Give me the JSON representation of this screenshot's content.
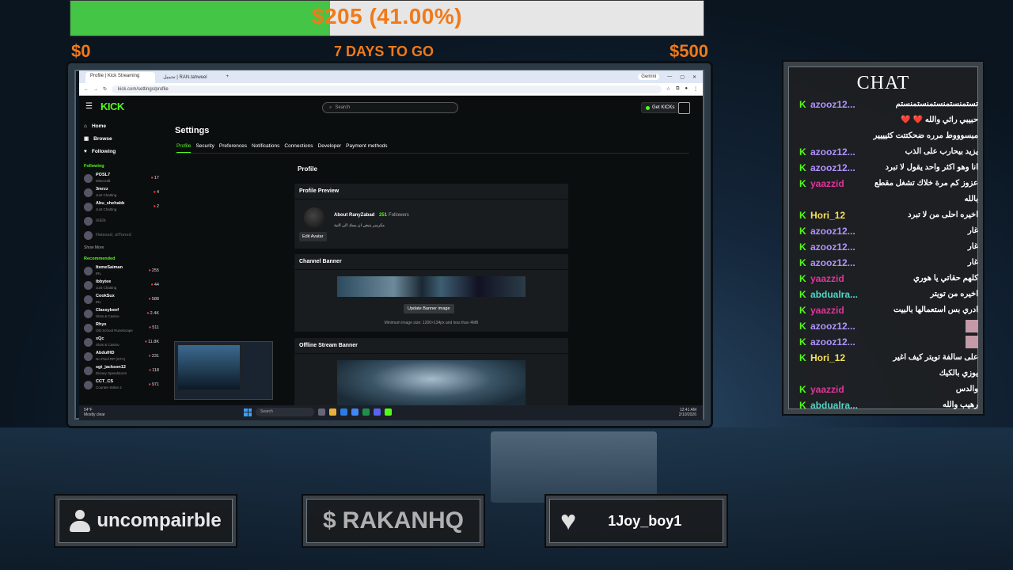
{
  "goal": {
    "amount_text": "$205 (41.00%)",
    "progress_pct": 41,
    "min": "$0",
    "max": "$500",
    "days_left": "7 DAYS TO GO"
  },
  "browser": {
    "tab1": "Profile | Kick Streaming",
    "tab2": "تحميل | RAN.tahweel",
    "gemini": "Gemini",
    "url": "kick.com/settings/profile"
  },
  "kick": {
    "logo": "KICK",
    "search_placeholder": "Search",
    "get_kicks": "Get KICKs",
    "nav": [
      {
        "label": "Home"
      },
      {
        "label": "Browse"
      },
      {
        "label": "Following"
      }
    ],
    "following_title": "Following",
    "following": [
      {
        "name": "POSL7",
        "cat": "Minecraft",
        "count": "17",
        "live": true
      },
      {
        "name": "3mrzz",
        "cat": "Just Chatting",
        "count": "4",
        "live": true
      },
      {
        "name": "Abu_shehabb",
        "cat": "Just Chatting",
        "count": "2",
        "live": true
      },
      {
        "name": "iiiElk",
        "cat": "",
        "count": "",
        "live": false
      },
      {
        "name": "Haiasad_alTonsd",
        "cat": "",
        "count": "",
        "live": false
      }
    ],
    "show_more": "Show More",
    "recommended_title": "Recommended",
    "recommended": [
      {
        "name": "ItsmeSaiman",
        "cat": "IRL",
        "count": "255"
      },
      {
        "name": "ibbytee",
        "cat": "Just Chatting",
        "count": "44"
      },
      {
        "name": "CookSux",
        "cat": "IRL",
        "count": "588"
      },
      {
        "name": "Classybeef",
        "cat": "Slots & Casino",
        "count": "2.4K"
      },
      {
        "name": "Rhys",
        "cat": "Old School RuneScape",
        "count": "511"
      },
      {
        "name": "xQc",
        "cat": "Slots & Casino",
        "count": "11.8K"
      },
      {
        "name": "AbduIHD",
        "cat": "No Pixel RP (GTA)",
        "count": "231"
      },
      {
        "name": "sgt_jackson12",
        "cat": "Disney Speedstorm",
        "count": "118"
      },
      {
        "name": "CCT_CS",
        "cat": "Counter-Strike 2",
        "count": "971"
      }
    ],
    "settings_title": "Settings",
    "tabs": [
      "Profile",
      "Security",
      "Preferences",
      "Notifications",
      "Connections",
      "Developer",
      "Payment methods"
    ],
    "page_title": "Profile",
    "preview": {
      "heading": "Profile Preview",
      "about": "About RanyZabad",
      "followers_count": "251",
      "followers_label": "Followers",
      "bio": "مكرمبر ينبغي ان يسك الى النية",
      "edit_avatar": "Edit Avatar"
    },
    "banner": {
      "heading": "Channel Banner",
      "update": "Update Banner image",
      "min": "Minimum image size: 1200×134px and less than 4MB"
    },
    "offline": {
      "heading": "Offline Stream Banner"
    }
  },
  "taskbar": {
    "weather_temp": "54°F",
    "weather_desc": "Mostly clear",
    "search": "Search",
    "time": "12:41 AM",
    "date": "2/10/2026"
  },
  "chat": {
    "title": "CHAT",
    "messages": [
      {
        "user": "azooz12...",
        "color": "#b294ff",
        "text": "تستمنستمنستمنستمنستم",
        "indent": false
      },
      {
        "user": "",
        "color": "#b294ff",
        "text": "حبيبي رائي والله ❤️ ❤️",
        "indent": true
      },
      {
        "user": "",
        "color": "#b294ff",
        "text": "مبسوووط مرره ضحكتتت كثيييير",
        "indent": true
      },
      {
        "user": "azooz12...",
        "color": "#b294ff",
        "text": "يزيد بيحارب على الذب",
        "indent": false
      },
      {
        "user": "azooz12...",
        "color": "#b294ff",
        "text": "انا وهو اكثر واحد يقول لا تبرد",
        "indent": false
      },
      {
        "user": "yaazzid",
        "color": "#e0359a",
        "text": "عزوز كم مرة خلاك تشغل مقطع",
        "indent": true
      },
      {
        "user": "",
        "color": "#e0359a",
        "text": "بالله",
        "indent": true
      },
      {
        "user": "Hori_12",
        "color": "#f5e25a",
        "text": "اخيره احلى من لا تبرد",
        "indent": true
      },
      {
        "user": "azooz12...",
        "color": "#b294ff",
        "text": "غار",
        "indent": false
      },
      {
        "user": "azooz12...",
        "color": "#b294ff",
        "text": "غار",
        "indent": false
      },
      {
        "user": "azooz12...",
        "color": "#b294ff",
        "text": "غار",
        "indent": false
      },
      {
        "user": "yaazzid",
        "color": "#e0359a",
        "text": "كلهم حقاتي يا هوري",
        "indent": true
      },
      {
        "user": "abdualra...",
        "color": "#4fd6c8",
        "text": "اخيره من تويتر",
        "indent": false
      },
      {
        "user": "yaazzid",
        "color": "#e0359a",
        "text": "ادري بس استعمالها بالبيت",
        "indent": true
      },
      {
        "user": "azooz12...",
        "color": "#b294ff",
        "text": "",
        "emoji": true,
        "indent": false
      },
      {
        "user": "azooz12...",
        "color": "#b294ff",
        "text": "",
        "emoji": true,
        "indent": false
      },
      {
        "user": "Hori_12",
        "color": "#f5e25a",
        "text": "على سالفة تويتر كيف اغير",
        "indent": true
      },
      {
        "user": "",
        "color": "#f5e25a",
        "text": "يوزي بالكيك",
        "indent": true
      },
      {
        "user": "yaazzid",
        "color": "#e0359a",
        "text": "والدس",
        "indent": true
      },
      {
        "user": "abdualra...",
        "color": "#4fd6c8",
        "text": "رهيب والله",
        "indent": false
      }
    ]
  },
  "panels": {
    "follower": "uncompairble",
    "donor": "RAKANHQ",
    "sub": "1Joy_boy1"
  },
  "colors": {
    "kick_green": "#53fc18",
    "goal_orange": "#f07a1a"
  }
}
